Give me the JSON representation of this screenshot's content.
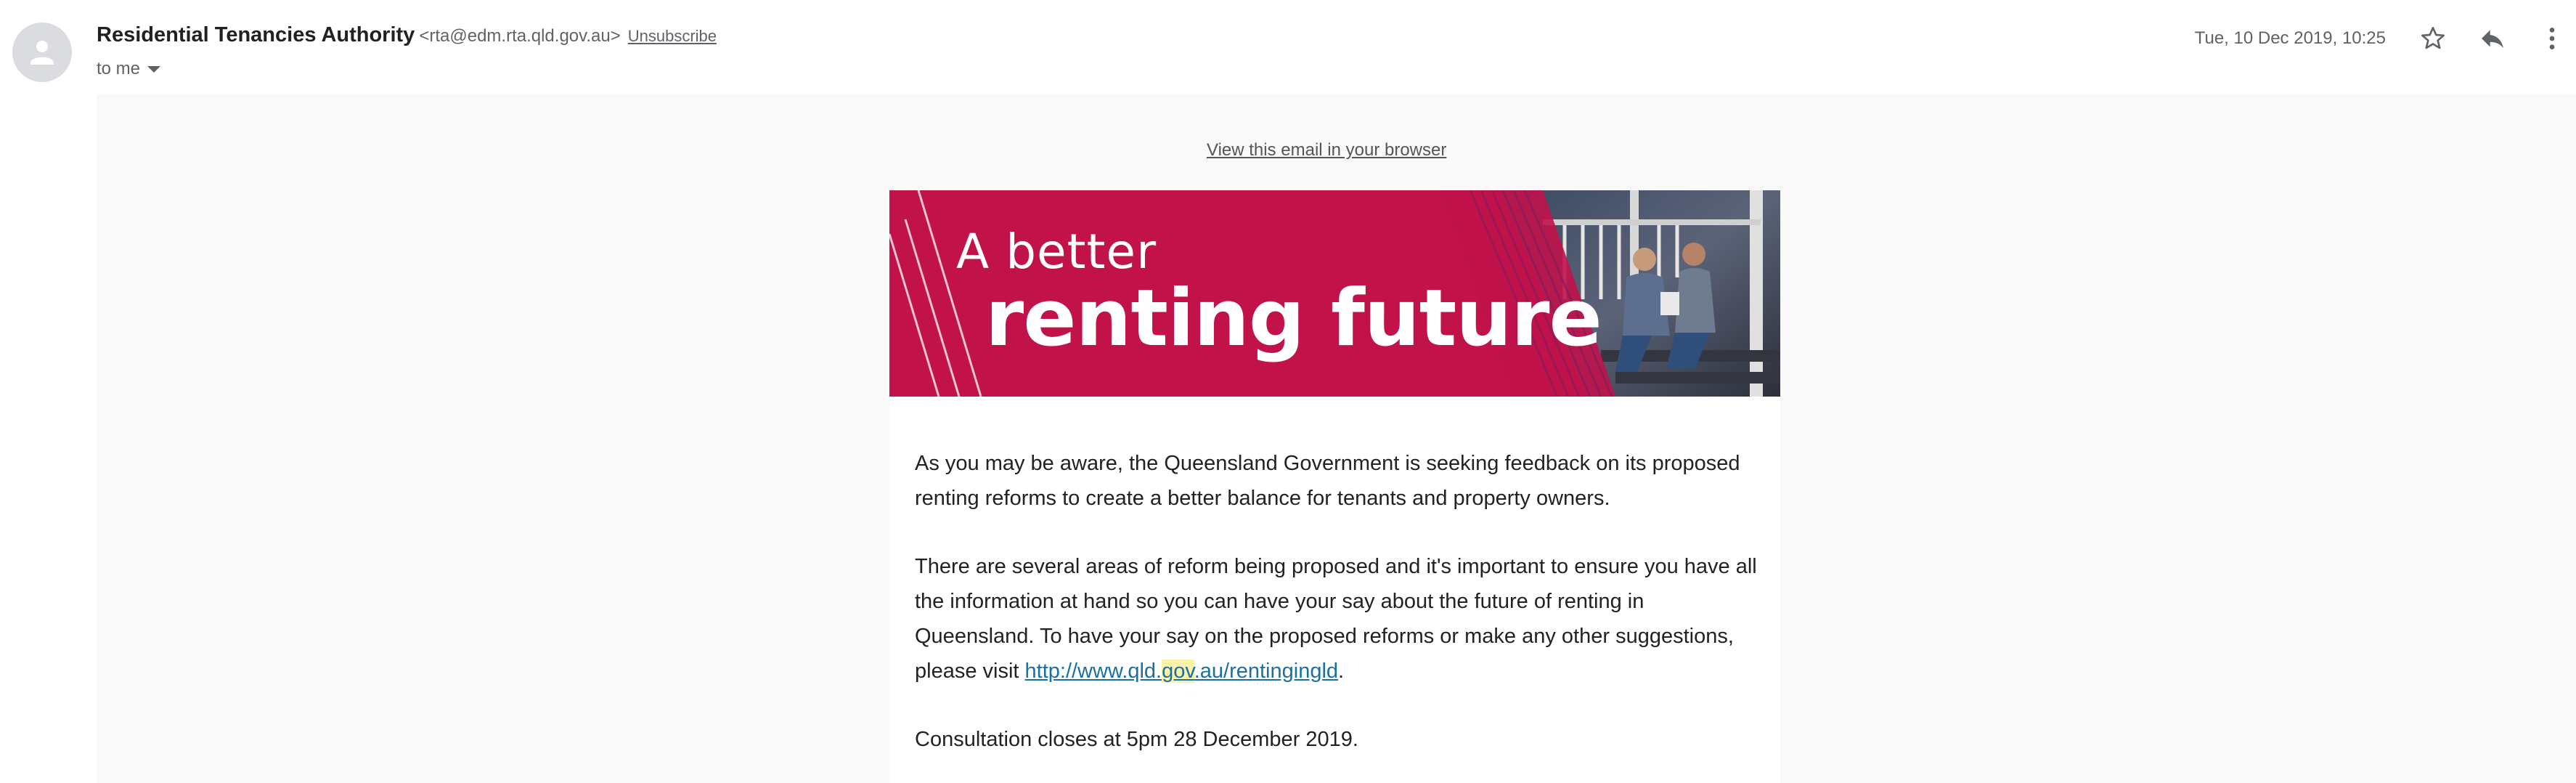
{
  "header": {
    "sender_name": "Residential Tenancies Authority",
    "sender_email": "<rta@edm.rta.qld.gov.au>",
    "unsubscribe_label": "Unsubscribe",
    "recipient_label": "to me",
    "date": "Tue, 10 Dec 2019, 10:25",
    "icons": [
      "avatar-person-icon",
      "star-icon",
      "reply-icon",
      "more-vert-icon",
      "chevron-down-icon"
    ]
  },
  "email": {
    "view_in_browser": "View this email in your browser",
    "banner": {
      "line1": "A better",
      "line2": "renting future"
    },
    "paragraph1": "As you may be aware, the Queensland Government is seeking feedback on its proposed renting reforms to create a better balance for tenants and property owners.",
    "paragraph2_text": "There are several areas of reform being proposed and it's important to ensure you have all the information at hand so you can have your say about the future of renting in Queensland. To have your say on the proposed reforms or make any other suggestions, please visit ",
    "link_part1": "http://www.qld.",
    "link_part2": "gov",
    "link_part3": ".au/rentingingld",
    "paragraph2_end": ".",
    "paragraph3": "Consultation closes at 5pm 28 December 2019."
  },
  "colors": {
    "banner_red": "#c1124a",
    "link_blue": "#1a6fa5",
    "highlight": "#fbf2a8"
  }
}
